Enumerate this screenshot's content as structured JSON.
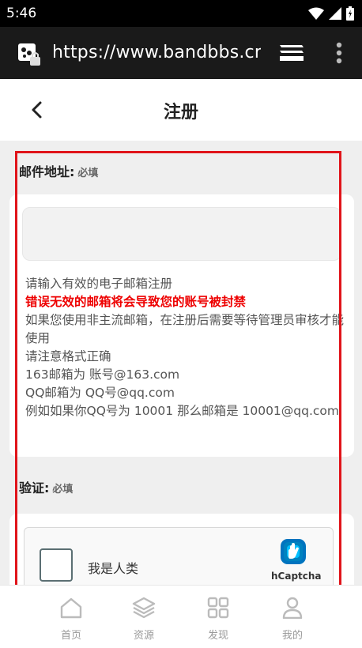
{
  "status_bar": {
    "time": "5:46"
  },
  "browser": {
    "url": "https://www.bandbbs.cn/"
  },
  "header": {
    "title": "注册"
  },
  "email": {
    "label": "邮件地址:",
    "required": "必填",
    "input_value": "",
    "help_lines": [
      "请输入有效的电子邮箱注册",
      "错误无效的邮箱将会导致您的账号被封禁",
      "如果您使用非主流邮箱，在注册后需要等待管理员审核才能使用",
      "请注意格式正确",
      "163邮箱为 账号@163.com",
      "QQ邮箱为 QQ号@qq.com",
      "例如如果你QQ号为 10001 那么邮箱是 10001@qq.com"
    ]
  },
  "verify": {
    "label": "验证:",
    "required": "必填",
    "captcha_text": "我是人类",
    "captcha_brand": "hCaptcha"
  },
  "bottom_nav": [
    {
      "label": "首页",
      "icon": "home-icon"
    },
    {
      "label": "资源",
      "icon": "layers-icon"
    },
    {
      "label": "发现",
      "icon": "grid-icon"
    },
    {
      "label": "我的",
      "icon": "user-icon"
    }
  ],
  "colors": {
    "warning": "#ee0000",
    "highlight": "#e0141a",
    "captcha_blue": "#0074bf"
  }
}
